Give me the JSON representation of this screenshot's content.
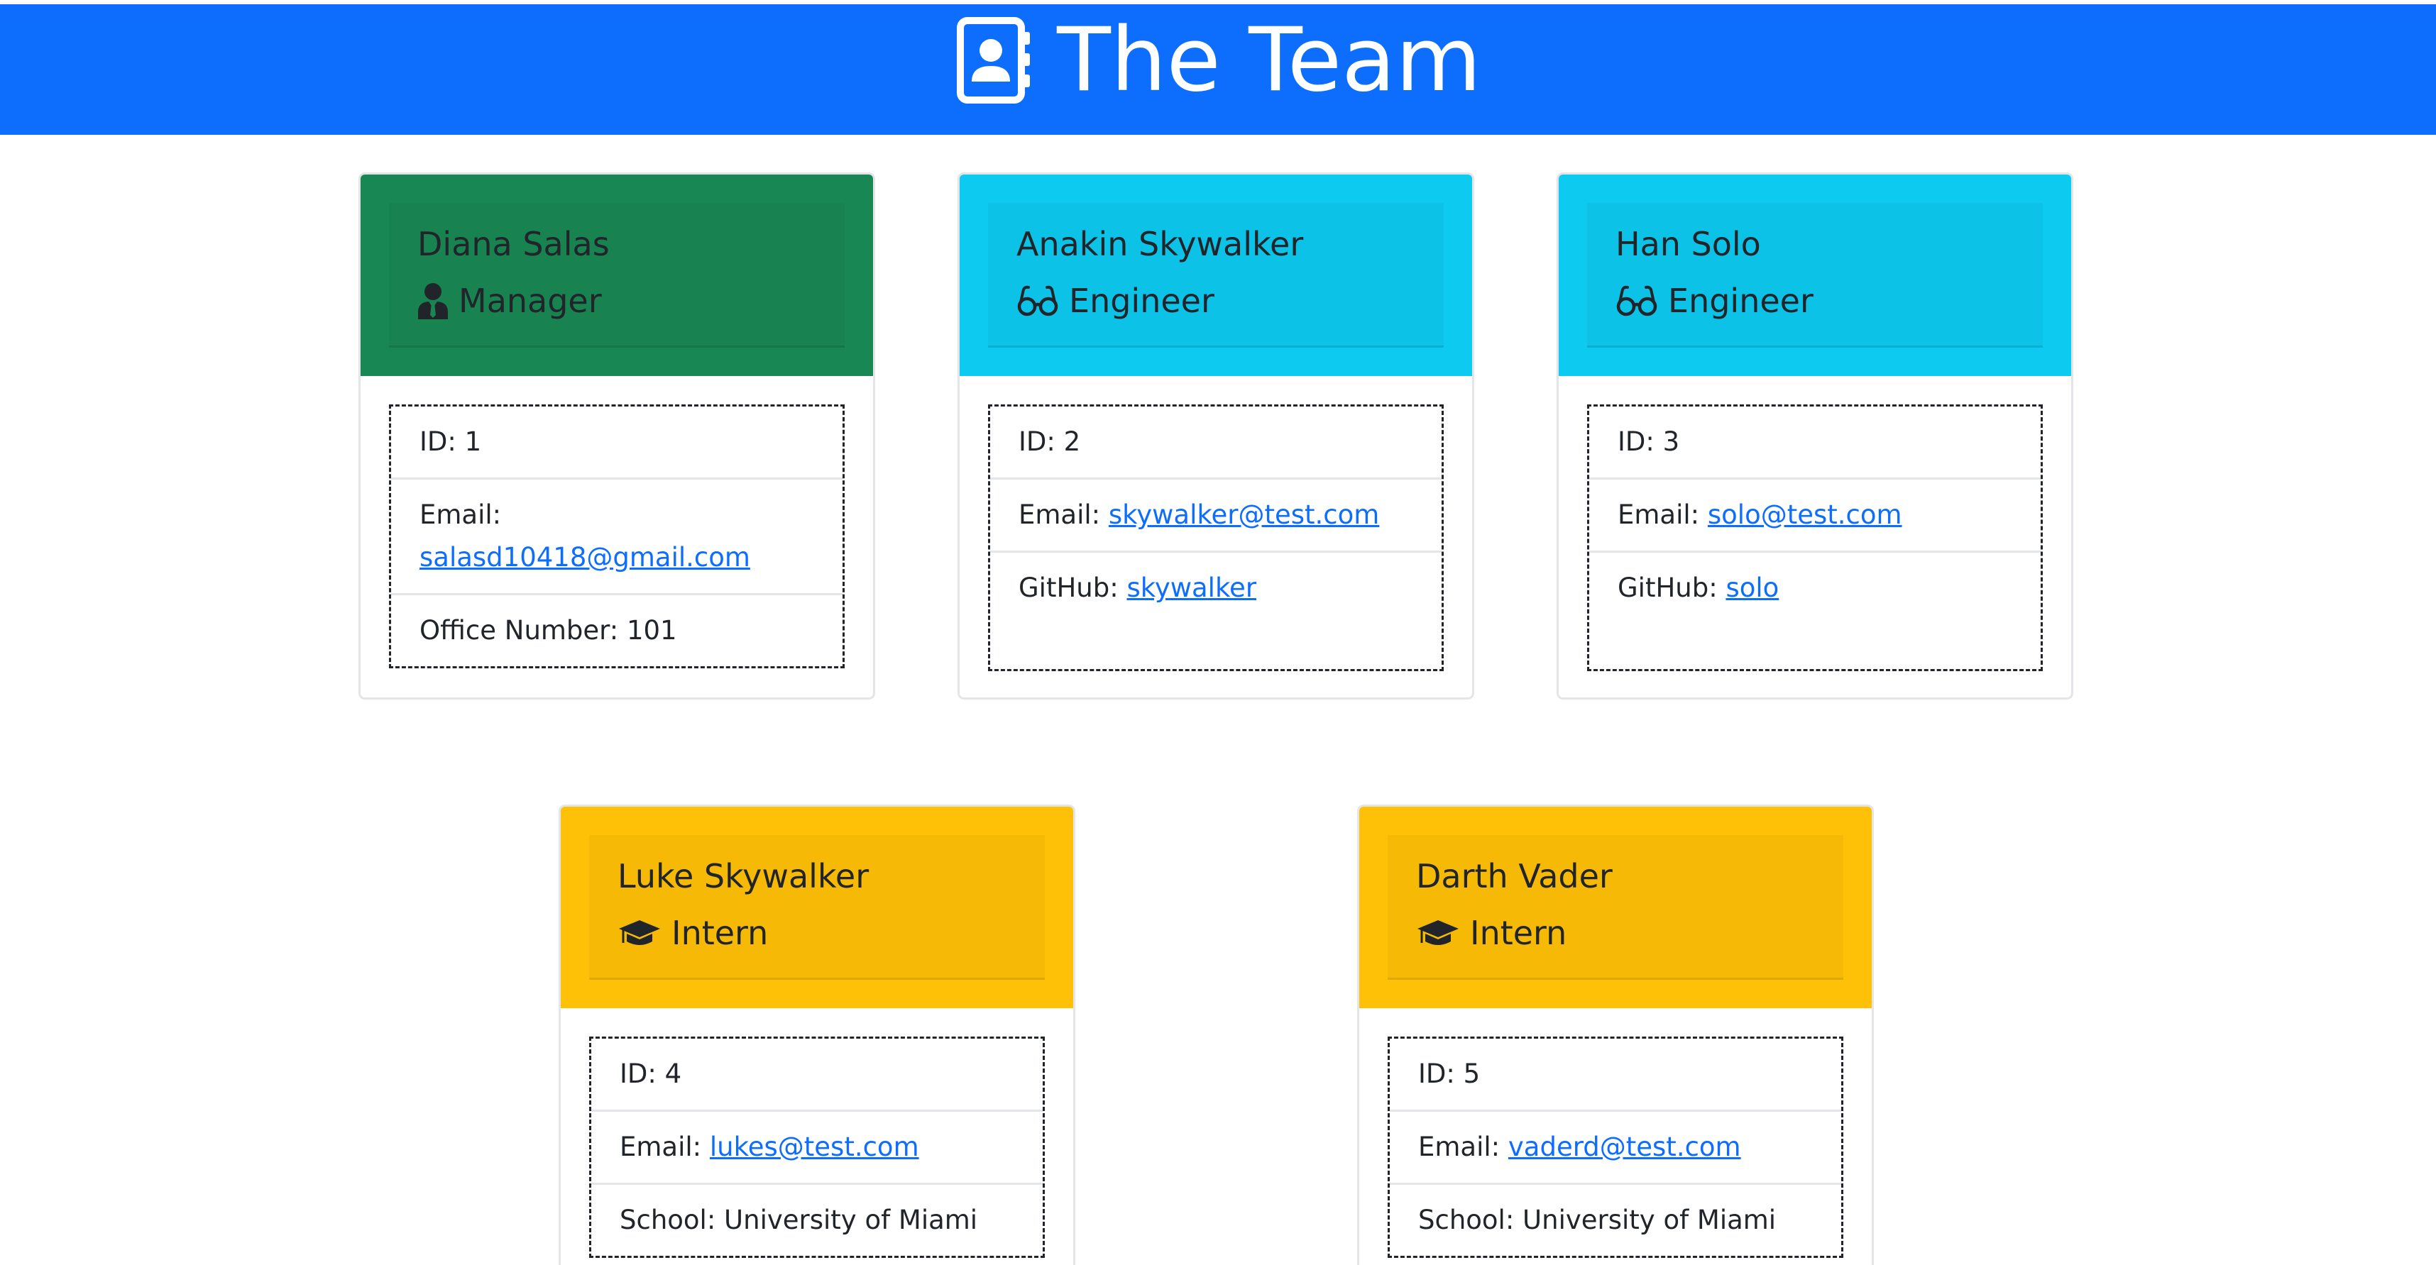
{
  "header": {
    "title": "The Team",
    "icon": "address-book-icon"
  },
  "colors": {
    "header_bg": "#0d6efd",
    "manager": "#198754",
    "engineer": "#0dcaf0",
    "intern": "#ffc107",
    "link": "#0d6efd"
  },
  "cards": [
    {
      "name": "Diana Salas",
      "role": "Manager",
      "role_icon": "user-tie-icon",
      "id_text": "ID: 1",
      "email_label": "Email:",
      "email": "salasd10418@gmail.com",
      "extra_text": "Office Number: 101"
    },
    {
      "name": "Anakin Skywalker",
      "role": "Engineer",
      "role_icon": "glasses-icon",
      "id_text": "ID: 2",
      "email_label": "Email:",
      "email": "skywalker@test.com",
      "extra_label": "GitHub:",
      "extra_link": "skywalker"
    },
    {
      "name": "Han Solo",
      "role": "Engineer",
      "role_icon": "glasses-icon",
      "id_text": "ID: 3",
      "email_label": "Email:",
      "email": "solo@test.com",
      "extra_label": "GitHub:",
      "extra_link": "solo"
    },
    {
      "name": "Luke Skywalker",
      "role": "Intern",
      "role_icon": "graduation-cap-icon",
      "id_text": "ID: 4",
      "email_label": "Email:",
      "email": "lukes@test.com",
      "extra_text": "School: University of Miami"
    },
    {
      "name": "Darth Vader",
      "role": "Intern",
      "role_icon": "graduation-cap-icon",
      "id_text": "ID: 5",
      "email_label": "Email:",
      "email": "vaderd@test.com",
      "extra_text": "School: University of Miami"
    }
  ]
}
